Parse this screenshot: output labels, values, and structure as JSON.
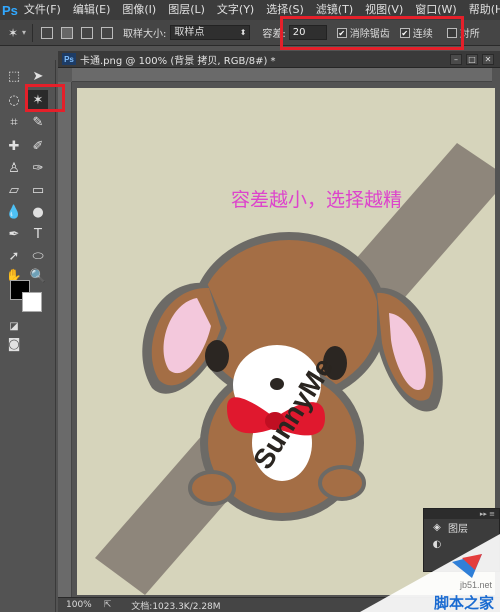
{
  "menubar": {
    "logo": "Ps",
    "items": [
      "文件(F)",
      "编辑(E)",
      "图像(I)",
      "图层(L)",
      "文字(Y)",
      "选择(S)",
      "滤镜(T)",
      "视图(V)",
      "窗口(W)",
      "帮助(H)"
    ]
  },
  "optbar": {
    "sample_size_label": "取样大小:",
    "sample_size_value": "取样点",
    "tolerance_label": "容差:",
    "tolerance_value": "20",
    "antialias_label": "消除锯齿",
    "contiguous_label": "连续",
    "all_layers_label": "对所"
  },
  "document": {
    "title": "卡通.png @ 100% (背景 拷贝, RGB/8#) *",
    "annotation": "容差越小，选择越精",
    "canvas_watermark": "SunnyMe"
  },
  "statusbar": {
    "zoom": "100%",
    "doc_size": "文档:1023.3K/2.28M"
  },
  "layers_panel": {
    "label": "图层"
  },
  "site_watermark": {
    "url": "jb51.net",
    "name": "脚本之家"
  },
  "colors": {
    "highlight": "#e5202a",
    "canvas_bg": "#d6d4bb",
    "annotation": "#dd44cc"
  }
}
